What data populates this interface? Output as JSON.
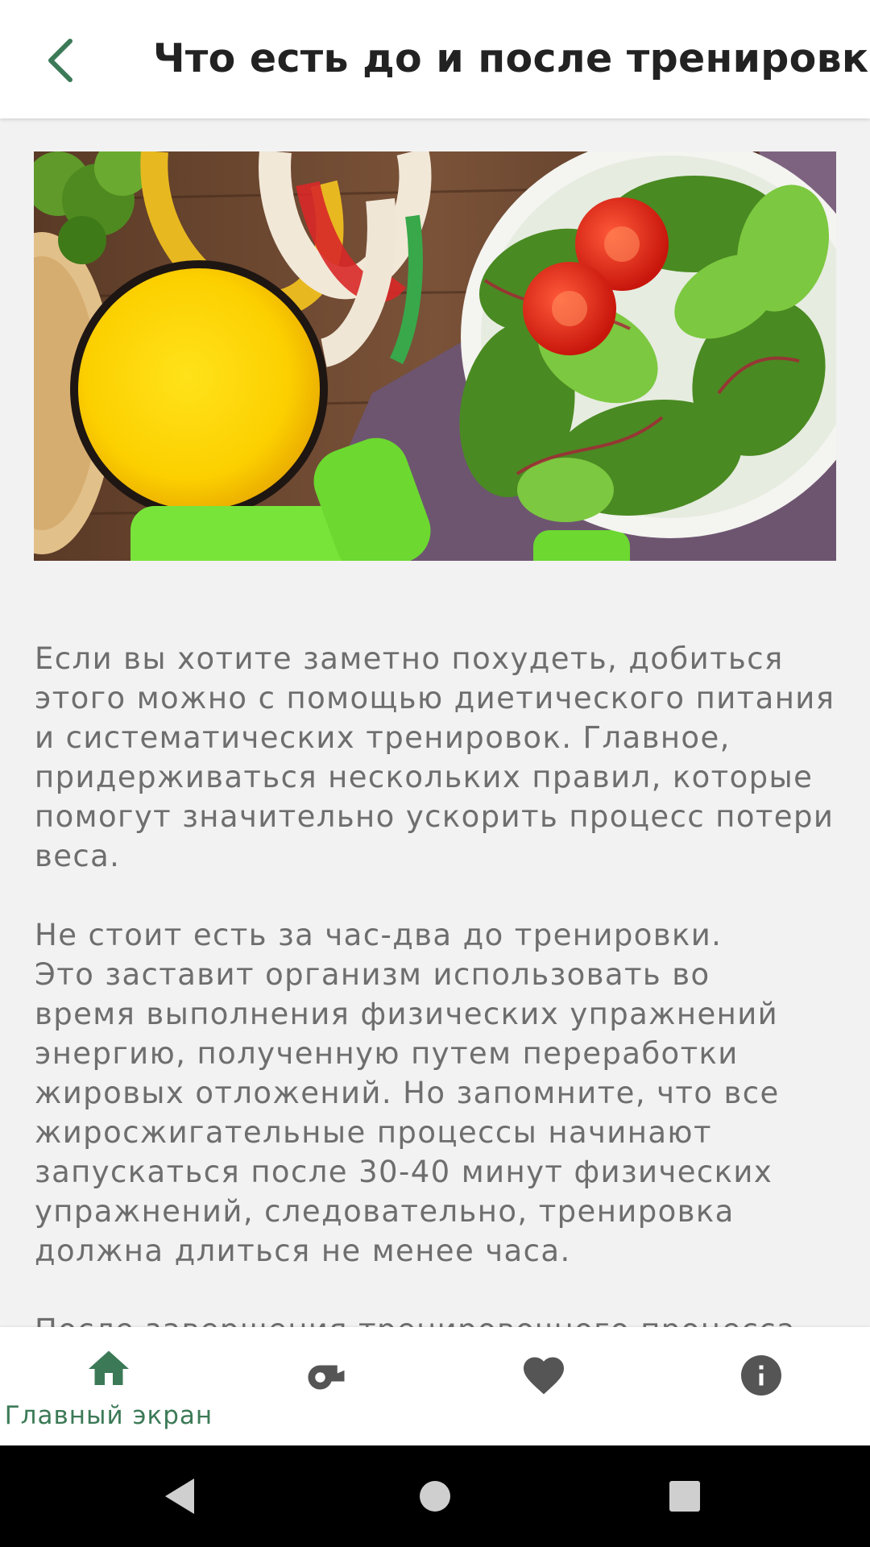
{
  "appbar": {
    "title": "Что есть до и после тренировки",
    "back_icon": "chevron-left-icon",
    "accent_color": "#3c7a57"
  },
  "hero_image": {
    "description_icon": "food-photo"
  },
  "article": {
    "paragraphs": [
      "Если вы хотите заметно похудеть, добиться\nэтого можно с помощью диетического питания\nи систематических тренировок. Главное,\nпридерживаться нескольких правил, которые\nпомогут значительно ускорить процесс потери\nвеса.",
      "Не стоит есть за час-два до тренировки.\nЭто заставит организм использовать во\nвремя выполнения физических упражнений\nэнергию, полученную путем переработки\nжировых отложений. Но запомните, что все\nжиросжигательные процессы начинают\nзапускаться после 30-40 минут физических\nупражнений, следовательно, тренировка\nдолжна длиться не менее часа.",
      "После завершения тренировочного процесса\nжелательно воздержаться от приема пищи"
    ]
  },
  "bottom_nav": {
    "items": [
      {
        "label": "Главный экран",
        "icon": "home-icon",
        "active": true
      },
      {
        "label": "",
        "icon": "whistle-icon",
        "active": false
      },
      {
        "label": "",
        "icon": "heart-icon",
        "active": false
      },
      {
        "label": "",
        "icon": "info-icon",
        "active": false
      }
    ],
    "active_color": "#3c7a57",
    "inactive_color": "#555555"
  },
  "system_nav": {
    "buttons": [
      "back-triangle-icon",
      "home-circle-icon",
      "recents-square-icon"
    ]
  }
}
